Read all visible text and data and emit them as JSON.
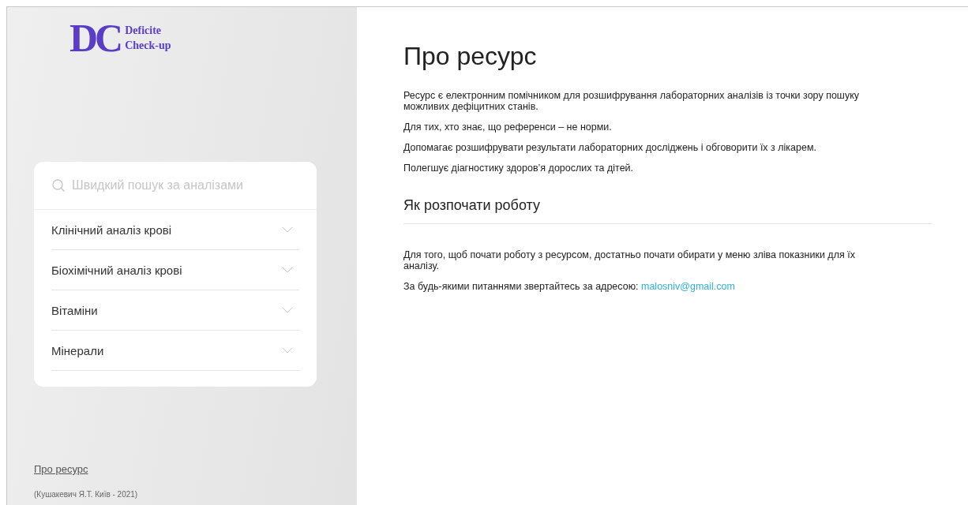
{
  "logo": {
    "mark": "DC",
    "lines": [
      "Deficite",
      "Check-up"
    ]
  },
  "search": {
    "placeholder": "Швидкий пошук за аналізами"
  },
  "menu": [
    {
      "label": "Клінічний аналіз крові",
      "expanded": false
    },
    {
      "label": "Біохімічний аналіз крові",
      "expanded": false
    },
    {
      "label": "Вітаміни",
      "expanded": false
    },
    {
      "label": "Мінерали",
      "expanded": false
    }
  ],
  "footer": {
    "link": "Про ресурс",
    "credit": "(Кушакевич Я.Т. Київ - 2021)"
  },
  "main": {
    "title": "Про ресурс",
    "paragraphs": [
      "Ресурс є електронним помічником для розшифрування лабораторних аналізів із точки зору пошуку можливих дефіцитних станів.",
      "Для тих, хто знає, що референси – не норми.",
      "Допомагає розшифрувати результати лабораторних досліджень і обговорити їх з лікарем.",
      "Полегшує діагностику здоров’я дорослих та дітей."
    ],
    "section": {
      "heading": "Як розпочати роботу",
      "paragraphs": [
        {
          "text": "Для того, щоб почати роботу з ресурсом, достатньо почати обирати у меню зліва показники для їх аналізу."
        },
        {
          "text": "За будь-якими питаннями звертайтесь за адресою:",
          "link": "malosniv@gmail.com"
        }
      ]
    }
  }
}
